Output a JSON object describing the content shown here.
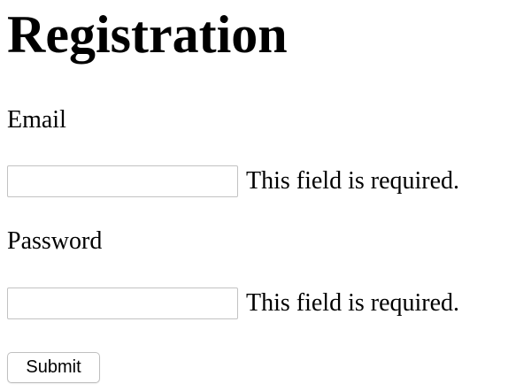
{
  "page": {
    "title": "Registration"
  },
  "form": {
    "email": {
      "label": "Email",
      "value": "",
      "placeholder": "",
      "error": "This field is required."
    },
    "password": {
      "label": "Password",
      "value": "",
      "placeholder": "",
      "error": "This field is required."
    },
    "submit_label": "Submit"
  }
}
